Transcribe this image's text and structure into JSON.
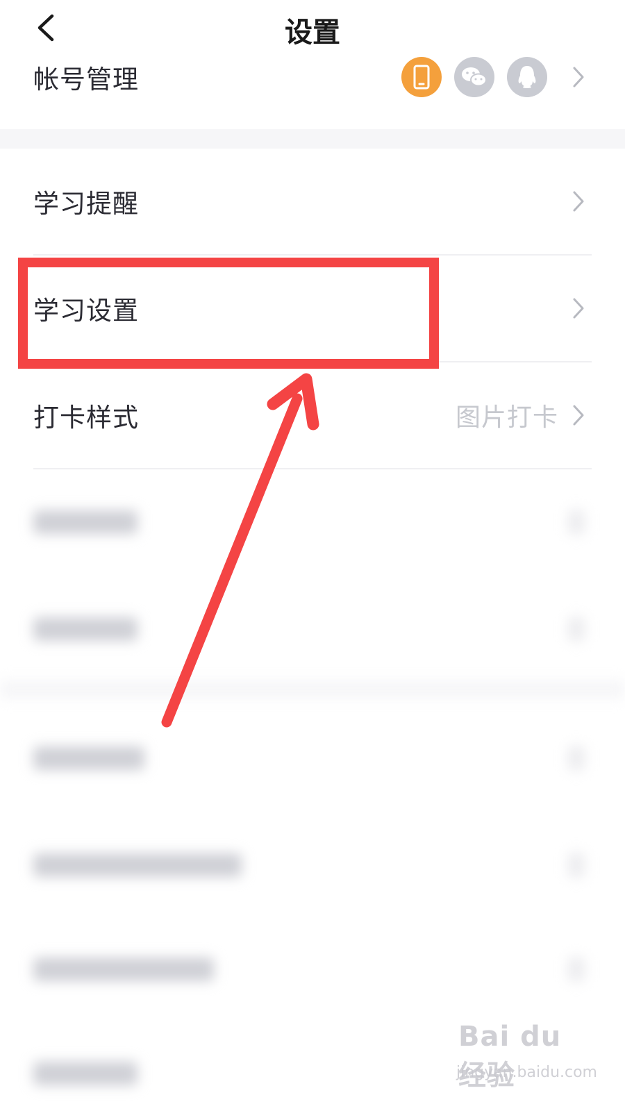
{
  "header": {
    "title": "设置"
  },
  "account": {
    "label": "帐号管理",
    "bindings": [
      {
        "icon": "phone-icon",
        "color": "#f4a03c"
      },
      {
        "icon": "wechat-icon",
        "color": "#c9cbd2"
      },
      {
        "icon": "qq-icon",
        "color": "#c9cbd2"
      }
    ]
  },
  "settings_items": [
    {
      "label": "学习提醒",
      "value": ""
    },
    {
      "label": "学习设置",
      "value": ""
    },
    {
      "label": "打卡样式",
      "value": "图片打卡"
    }
  ],
  "annotation": {
    "highlight_color": "#f44444",
    "arrow_color": "#f44444"
  },
  "watermark": {
    "brand": "Bai du 经验",
    "url": "jingyan.baidu.com"
  }
}
